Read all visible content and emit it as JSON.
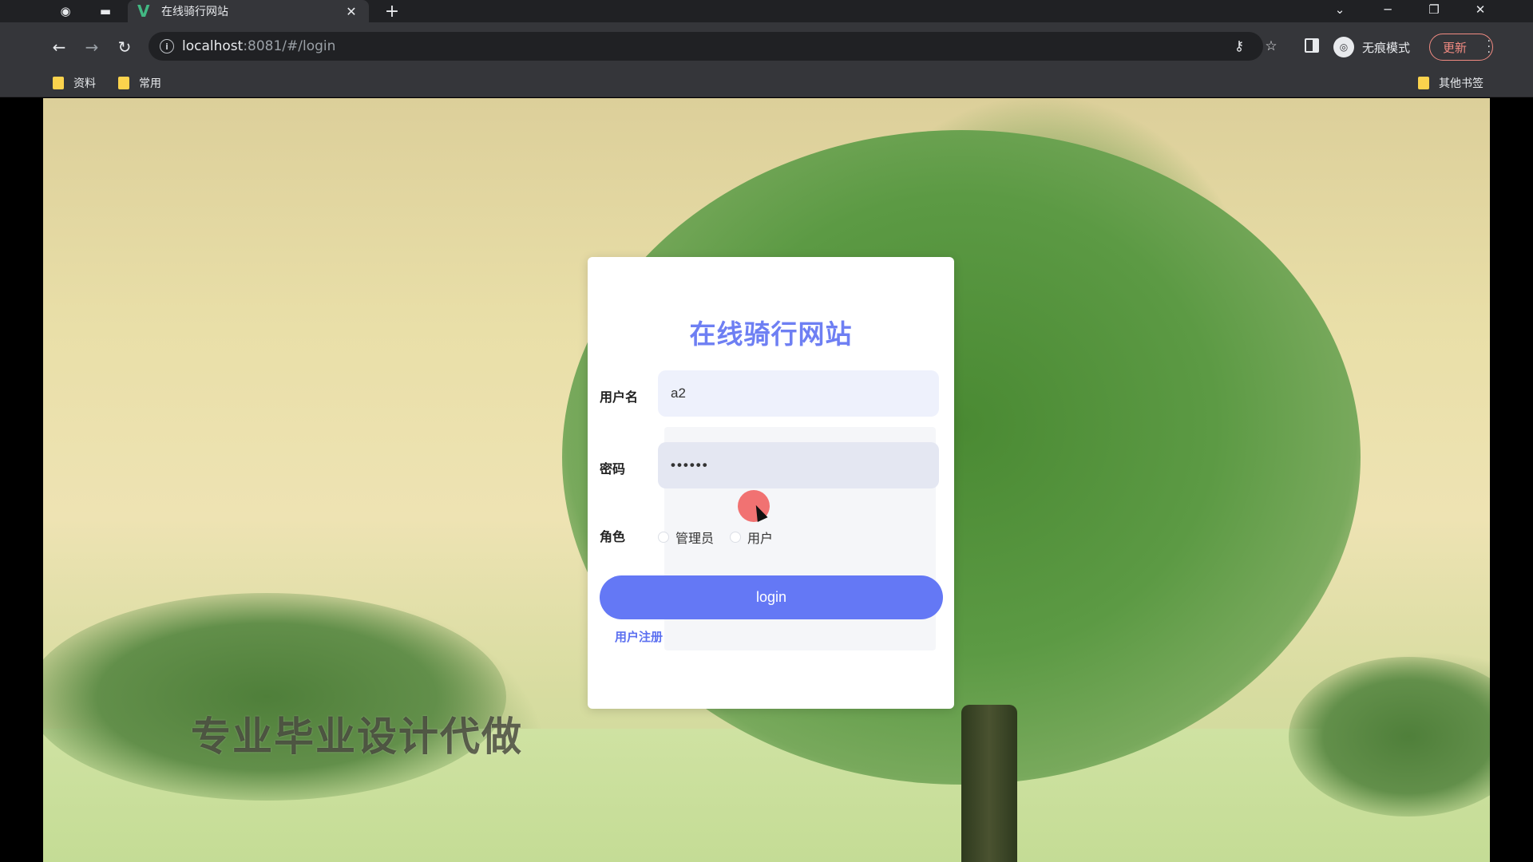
{
  "browser": {
    "tab_title": "在线骑行网站",
    "tab_favicon": "V",
    "url_host": "localhost",
    "url_rest": ":8081/#/login",
    "incognito_label": "无痕模式",
    "update_label": "更新",
    "bookmarks": [
      "资料",
      "常用"
    ],
    "other_bookmarks": "其他书签"
  },
  "login": {
    "title": "在线骑行网站",
    "username_label": "用户名",
    "username_value": "a2",
    "password_label": "密码",
    "password_value": "••••••",
    "role_label": "角色",
    "role_options": [
      "管理员",
      "用户"
    ],
    "submit_label": "login",
    "register_link": "用户注册"
  },
  "watermark": "专业毕业设计代做",
  "colors": {
    "accent": "#6478f5",
    "title": "#6e7ff3",
    "tab_bar": "#202124",
    "toolbar": "#35363a"
  }
}
